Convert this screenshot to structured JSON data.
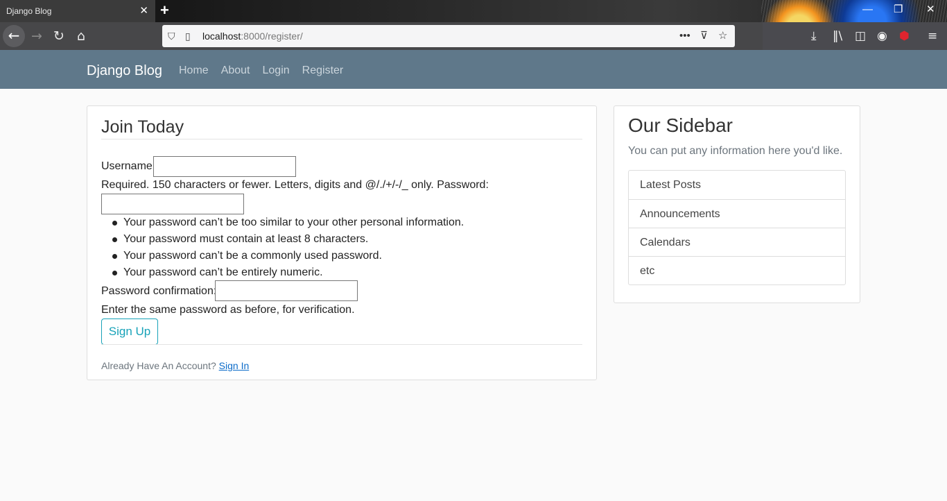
{
  "browser": {
    "tab_title": "Django Blog",
    "tab_close": "✕",
    "new_tab": "+",
    "url_host": "localhost",
    "url_rest": ":8000/register/",
    "win_minimize": "—",
    "win_restore": "❐",
    "win_close": "✕",
    "icons": [
      "back-arrow-icon",
      "forward-arrow-icon",
      "reload-icon",
      "home-icon",
      "shield-icon",
      "page-icon",
      "more-icon",
      "pocket-icon",
      "star-icon",
      "download-icon",
      "library-icon",
      "sidebar-icon",
      "account-icon",
      "lock-icon",
      "menu-icon"
    ]
  },
  "site": {
    "brand": "Django Blog",
    "nav": [
      "Home",
      "About",
      "Login",
      "Register"
    ],
    "nav_bg": "#5f788a"
  },
  "form": {
    "legend": "Join Today",
    "username_label": "Username:",
    "username_help": "Required. 150 characters or fewer. Letters, digits and @/./+/-/_ only.",
    "password_label": "Password:",
    "password_help": [
      "Your password can’t be too similar to your other personal information.",
      "Your password must contain at least 8 characters.",
      "Your password can’t be a commonly used password.",
      "Your password can’t be entirely numeric."
    ],
    "confirm_label": "Password confirmation:",
    "confirm_help": "Enter the same password as before, for verification.",
    "submit": "Sign Up",
    "submit_color": "#17a2b8",
    "already": "Already Have An Account?",
    "signin": "Sign In"
  },
  "sidebar": {
    "title": "Our Sidebar",
    "description": "You can put any information here you'd like.",
    "items": [
      "Latest Posts",
      "Announcements",
      "Calendars",
      "etc"
    ]
  }
}
